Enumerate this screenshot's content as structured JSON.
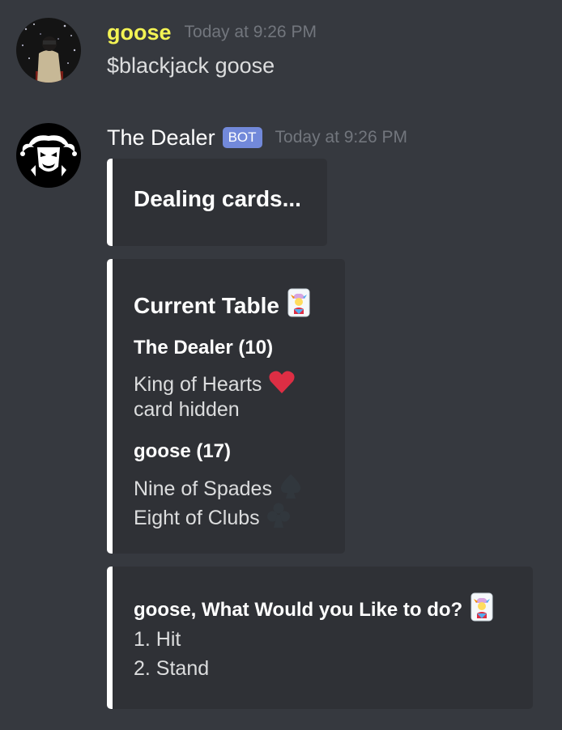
{
  "messages": [
    {
      "author": "goose",
      "timestamp": "Today at 9:26 PM",
      "content": "$blackjack goose"
    },
    {
      "author": "The Dealer",
      "bot_tag": "BOT",
      "timestamp": "Today at 9:26 PM",
      "embeds": [
        {
          "title": "Dealing cards..."
        },
        {
          "title": "Current Table",
          "title_icon": "joker-card-icon",
          "fields": [
            {
              "name": "The Dealer (10)",
              "lines": [
                {
                  "text": "King of Hearts",
                  "icon": "heart-icon"
                },
                {
                  "text": "card hidden"
                }
              ]
            },
            {
              "name": "goose (17)",
              "lines": [
                {
                  "text": "Nine of Spades",
                  "icon": "spade-icon"
                },
                {
                  "text": "Eight of Clubs",
                  "icon": "club-icon"
                }
              ]
            }
          ]
        },
        {
          "title": "goose, What Would you Like to do?",
          "title_icon": "joker-card-icon",
          "options": [
            "1. Hit",
            "2. Stand"
          ]
        }
      ]
    }
  ],
  "colors": {
    "background": "#36393f",
    "embed_background": "#2f3136",
    "embed_border": "#ffffff",
    "goose_name": "#f3f354",
    "bot_tag": "#7289da",
    "timestamp": "#72767d",
    "heart": "#dd2e44",
    "spade_club": "#31373d"
  }
}
